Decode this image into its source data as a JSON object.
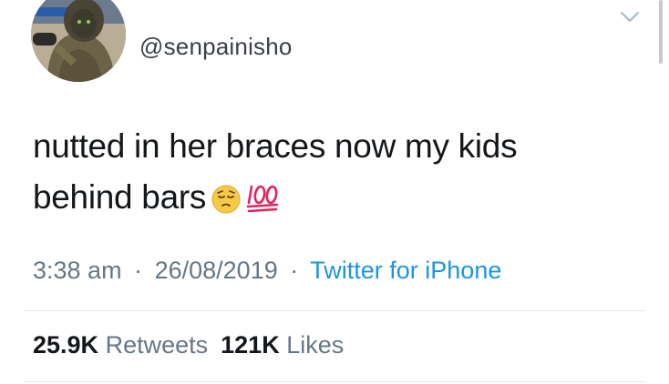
{
  "profile": {
    "handle": "@senpainisho"
  },
  "tweet": {
    "line1": "nutted in her braces now my kids",
    "line2": "behind bars",
    "emojis": [
      "pensive-face-icon",
      "hundred-points-icon"
    ]
  },
  "meta": {
    "time": "3:38 am",
    "separator": "·",
    "date": "26/08/2019",
    "source": "Twitter for iPhone"
  },
  "stats": {
    "retweets_count": "25.9K",
    "retweets_label": "Retweets",
    "likes_count": "121K",
    "likes_label": "Likes"
  },
  "colors": {
    "text": "#14171a",
    "secondary": "#657786",
    "link": "#1b95e0",
    "divider": "#e1e8ed"
  }
}
